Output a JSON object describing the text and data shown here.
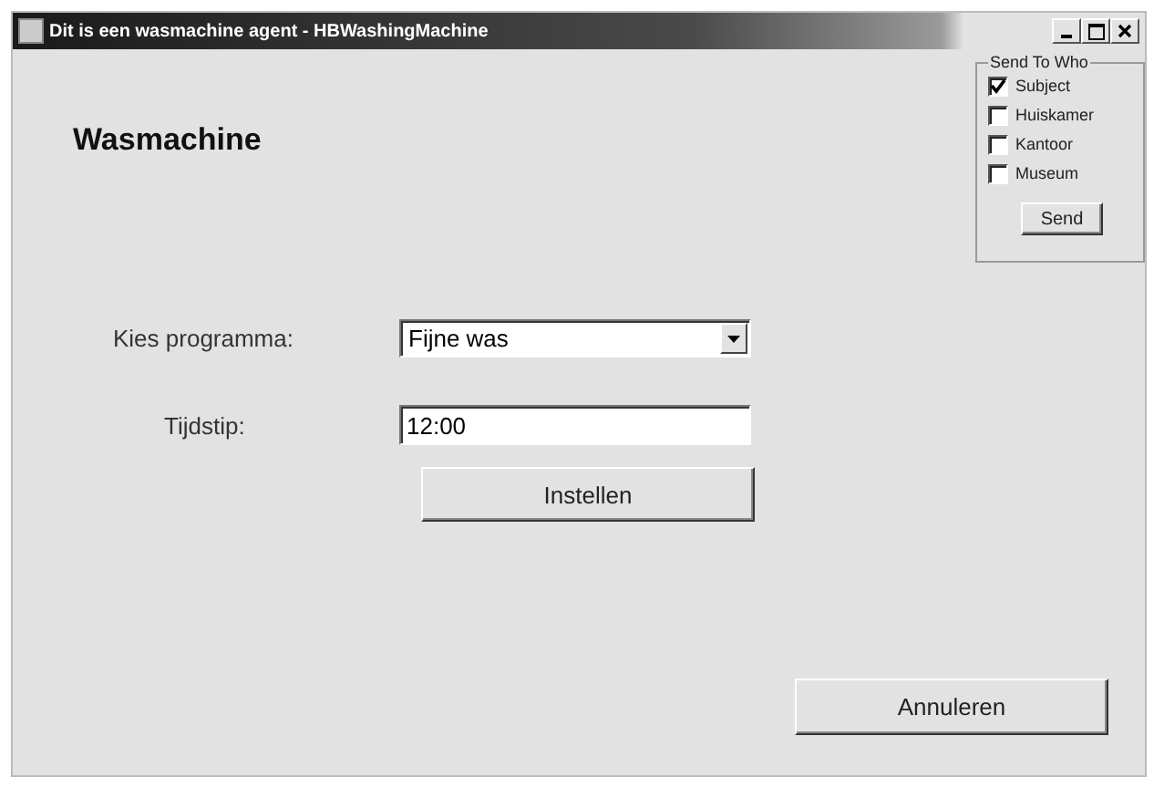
{
  "window": {
    "title": "Dit is een wasmachine agent - HBWashingMachine"
  },
  "heading": "Wasmachine",
  "program": {
    "label": "Kies programma:",
    "value": "Fijne was"
  },
  "time": {
    "label": "Tijdstip:",
    "value": "12:00"
  },
  "set_button": "Instellen",
  "cancel_button": "Annuleren",
  "send_to": {
    "legend": "Send To Who",
    "options": [
      {
        "label": "Subject",
        "checked": true
      },
      {
        "label": "Huiskamer",
        "checked": false
      },
      {
        "label": "Kantoor",
        "checked": false
      },
      {
        "label": "Museum",
        "checked": false
      }
    ],
    "button": "Send"
  }
}
